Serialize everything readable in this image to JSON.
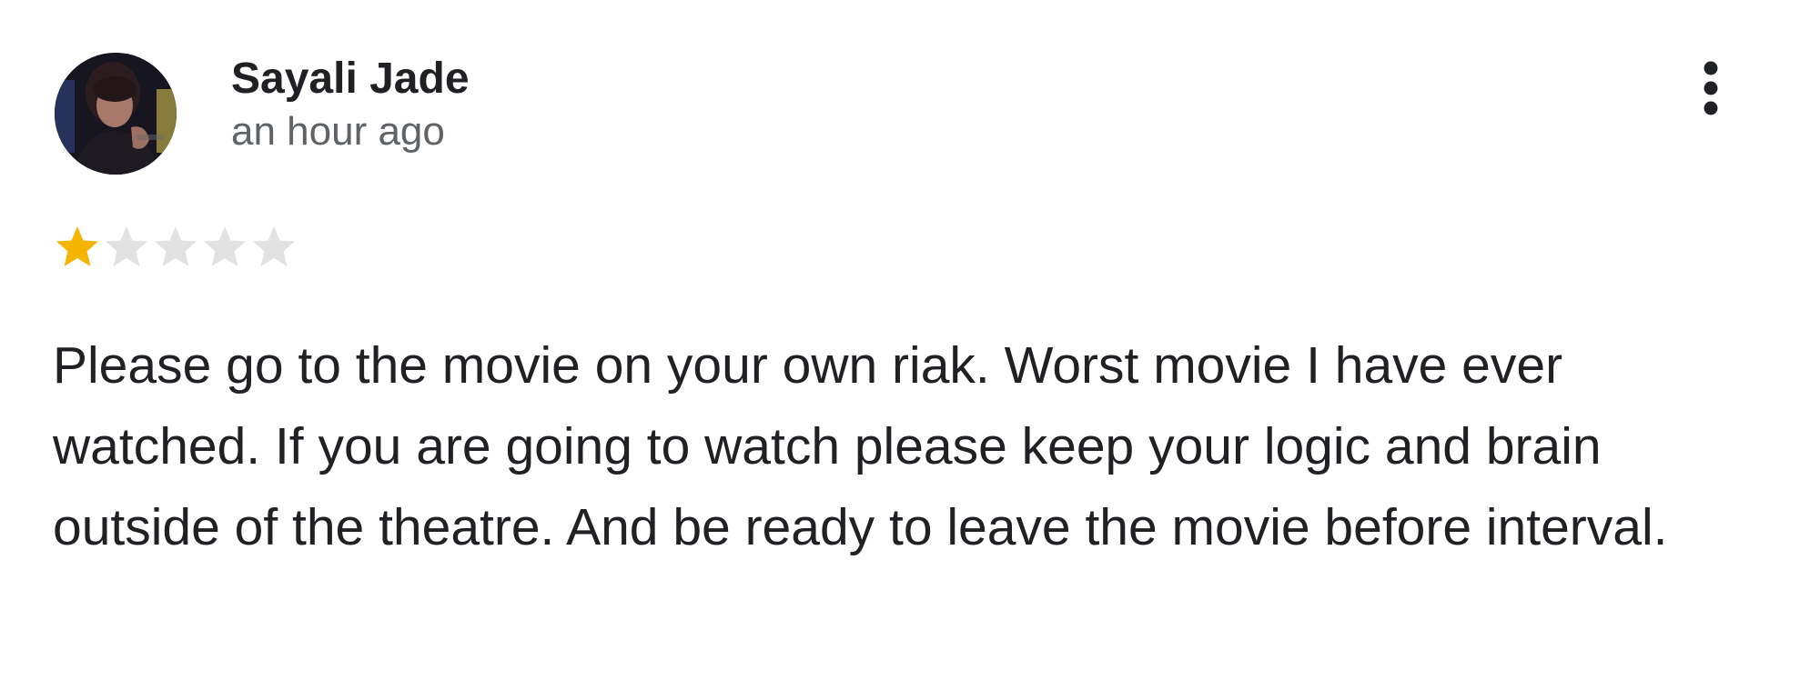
{
  "review": {
    "author": "Sayali Jade",
    "time": "an hour ago",
    "rating": 1,
    "max_rating": 5,
    "text": "Please go to the movie on your own riak. Worst movie I have ever watched. If you are going to watch please keep your logic and brain outside of the theatre. And be ready to leave the movie before interval."
  },
  "icons": {
    "avatar": "user-avatar",
    "more": "more-vert-icon",
    "star": "star-icon"
  },
  "colors": {
    "star_filled": "#f4b400",
    "star_empty": "#e2e2e2",
    "text_primary": "#202124",
    "text_secondary": "#5f6368"
  }
}
